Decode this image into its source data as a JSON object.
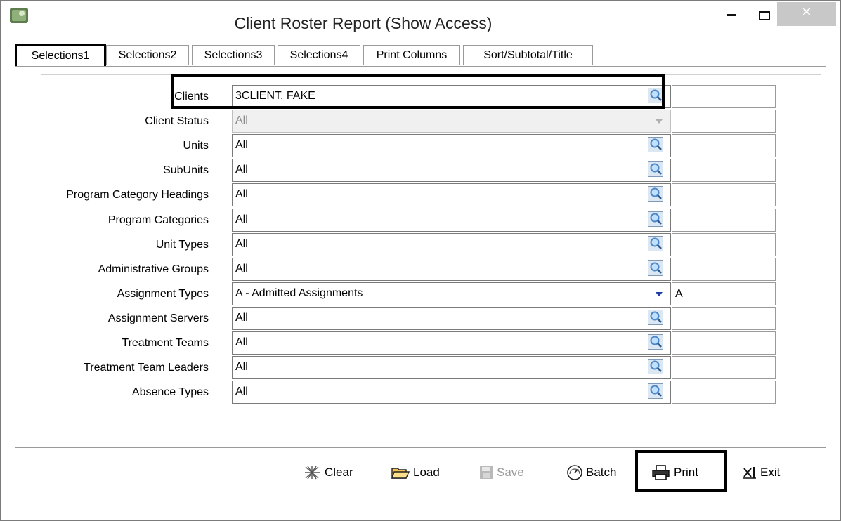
{
  "window": {
    "title": "Client Roster Report (Show Access)",
    "close_glyph": "✕"
  },
  "tabs": [
    {
      "label": "Selections1"
    },
    {
      "label": "Selections2"
    },
    {
      "label": "Selections3"
    },
    {
      "label": "Selections4"
    },
    {
      "label": "Print Columns"
    },
    {
      "label": "Sort/Subtotal/Title"
    }
  ],
  "rows": [
    {
      "label": "Clients",
      "value": "3CLIENT, FAKE",
      "control": "lookup",
      "side": ""
    },
    {
      "label": "Client Status",
      "value": "All",
      "control": "dropdown-disabled",
      "side": ""
    },
    {
      "label": "Units",
      "value": "All",
      "control": "lookup",
      "side": ""
    },
    {
      "label": "SubUnits",
      "value": "All",
      "control": "lookup",
      "side": ""
    },
    {
      "label": "Program Category Headings",
      "value": "All",
      "control": "lookup",
      "side": ""
    },
    {
      "label": "Program Categories",
      "value": "All",
      "control": "lookup",
      "side": ""
    },
    {
      "label": "Unit Types",
      "value": "All",
      "control": "lookup",
      "side": ""
    },
    {
      "label": "Administrative Groups",
      "value": "All",
      "control": "lookup",
      "side": ""
    },
    {
      "label": "Assignment Types",
      "value": "A - Admitted Assignments",
      "control": "dropdown",
      "side": "A"
    },
    {
      "label": "Assignment Servers",
      "value": "All",
      "control": "lookup",
      "side": ""
    },
    {
      "label": "Treatment Teams",
      "value": "All",
      "control": "lookup",
      "side": ""
    },
    {
      "label": "Treatment Team Leaders",
      "value": "All",
      "control": "lookup",
      "side": ""
    },
    {
      "label": "Absence Types",
      "value": "All",
      "control": "lookup",
      "side": ""
    }
  ],
  "buttons": {
    "clear": "Clear",
    "load": "Load",
    "save": "Save",
    "batch": "Batch",
    "print": "Print",
    "exit": "Exit"
  },
  "colors": {
    "lookup_icon": "#4a86c8",
    "dropdown_arrow": "#1f3fa8"
  }
}
